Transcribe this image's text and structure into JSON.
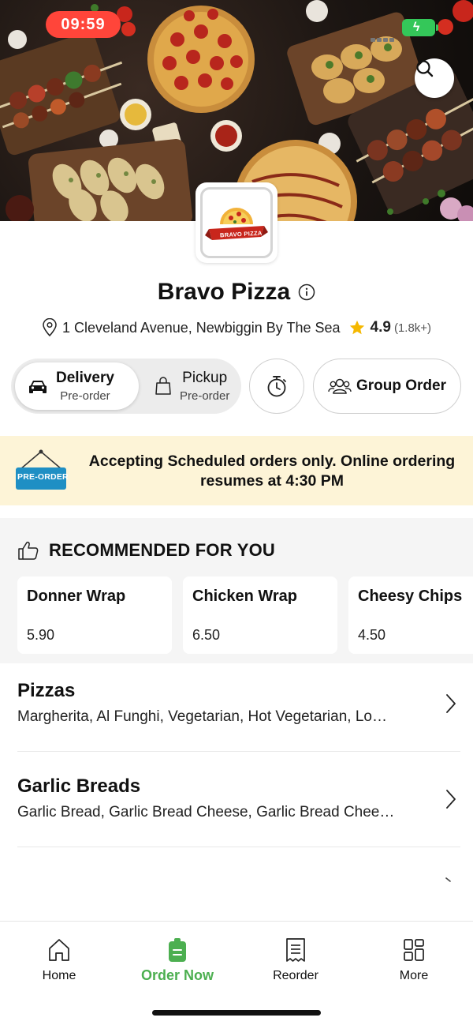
{
  "status_bar": {
    "time": "09:59"
  },
  "hero": {
    "search_icon": "search-icon"
  },
  "restaurant": {
    "logo_text": "BRAVO PIZZA",
    "name": "Bravo Pizza",
    "address": "1 Cleveland Avenue, Newbiggin By The Sea",
    "rating": "4.9",
    "rating_count": "(1.8k+)"
  },
  "order_modes": {
    "delivery": {
      "label": "Delivery",
      "sub": "Pre-order",
      "selected": true
    },
    "pickup": {
      "label": "Pickup",
      "sub": "Pre-order",
      "selected": false
    },
    "group_order_label": "Group Order"
  },
  "banner": {
    "tag": "PRE-ORDER",
    "message": "Accepting Scheduled orders only. Online ordering resumes at 4:30 PM"
  },
  "recommended": {
    "heading": "RECOMMENDED FOR YOU",
    "items": [
      {
        "name": "Donner Wrap",
        "price": "5.90"
      },
      {
        "name": "Chicken Wrap",
        "price": "6.50"
      },
      {
        "name": "Cheesy Chips",
        "price": "4.50"
      }
    ]
  },
  "categories": [
    {
      "name": "Pizzas",
      "description": "Margherita, Al Funghi, Vegetarian, Hot Vegetarian, Lo…"
    },
    {
      "name": "Garlic Breads",
      "description": "Garlic Bread, Garlic Bread Cheese, Garlic Bread Chee…"
    }
  ],
  "bottom_nav": [
    {
      "label": "Home",
      "icon": "home-icon",
      "active": false
    },
    {
      "label": "Order Now",
      "icon": "order-icon",
      "active": true
    },
    {
      "label": "Reorder",
      "icon": "receipt-icon",
      "active": false
    },
    {
      "label": "More",
      "icon": "grid-icon",
      "active": false
    }
  ],
  "colors": {
    "accent_green": "#4caf50",
    "banner_bg": "#fdf4d7",
    "time_pill": "#ff453a",
    "star": "#f5b800",
    "preorder_tag": "#1f8fc4"
  }
}
